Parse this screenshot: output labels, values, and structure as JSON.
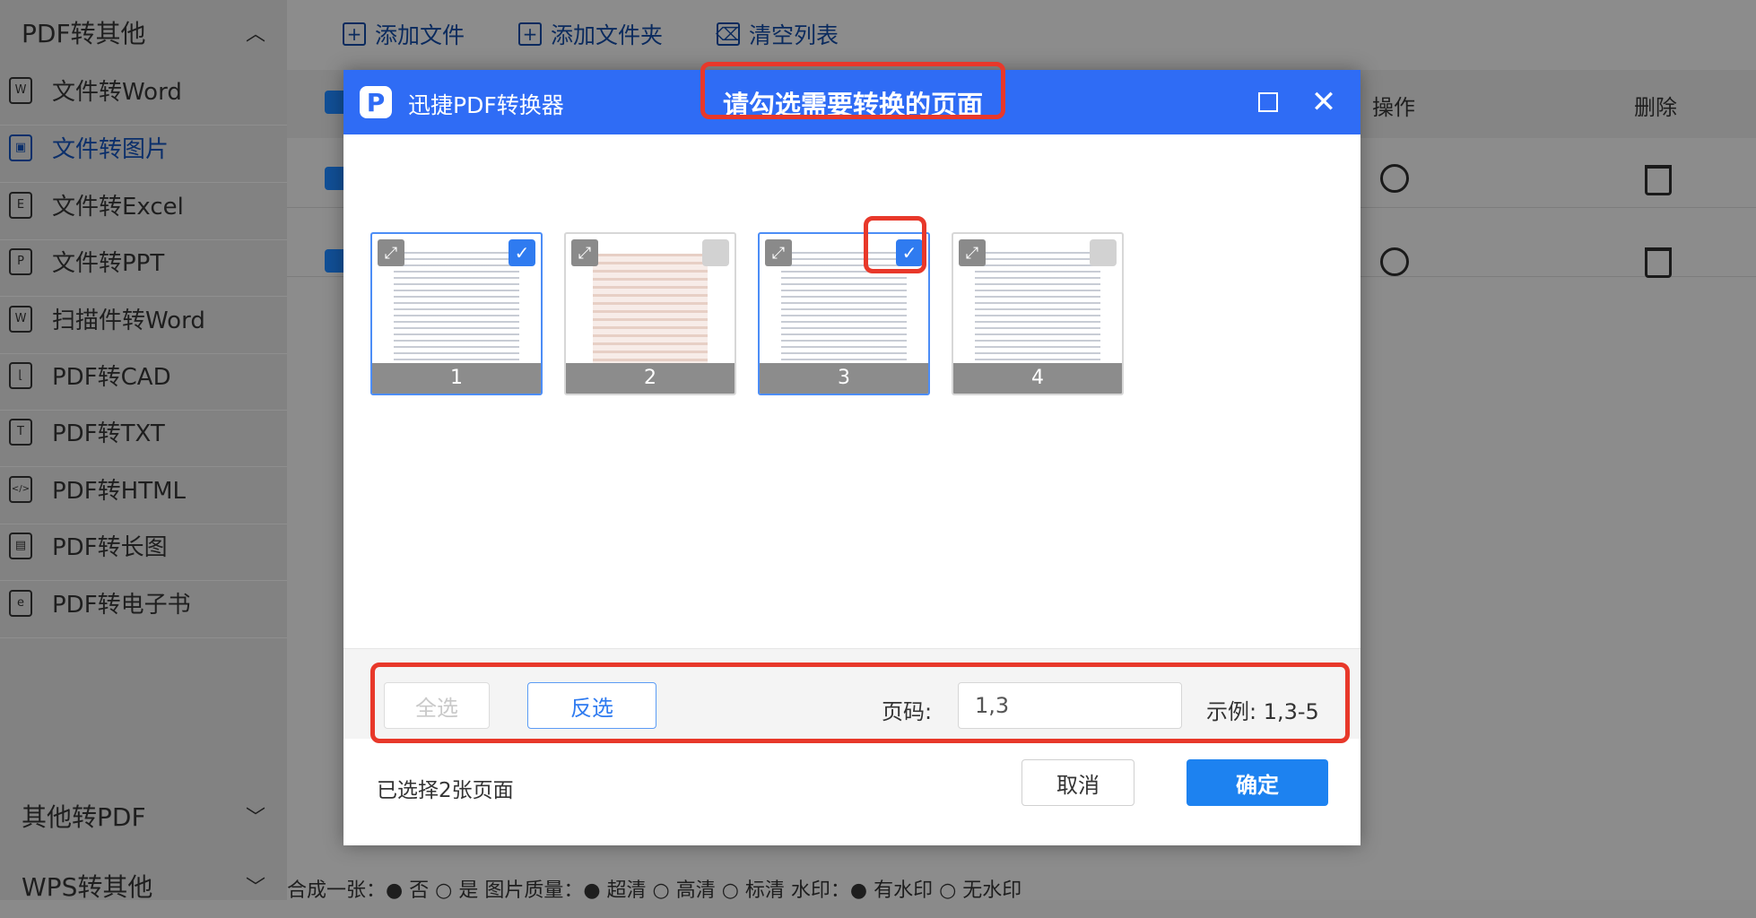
{
  "sidebar": {
    "group_top": "PDF转其他",
    "items": [
      {
        "label": "文件转Word",
        "icon": "W"
      },
      {
        "label": "文件转图片",
        "icon": "▣"
      },
      {
        "label": "文件转Excel",
        "icon": "E"
      },
      {
        "label": "文件转PPT",
        "icon": "P"
      },
      {
        "label": "扫描件转Word",
        "icon": "W"
      },
      {
        "label": "PDF转CAD",
        "icon": "⌊"
      },
      {
        "label": "PDF转TXT",
        "icon": "T"
      },
      {
        "label": "PDF转HTML",
        "icon": "</>"
      },
      {
        "label": "PDF转长图",
        "icon": "▤"
      },
      {
        "label": "PDF转电子书",
        "icon": "e"
      }
    ],
    "group_other": "其他转PDF",
    "group_wps": "WPS转其他",
    "active_index": 1
  },
  "toolbar": {
    "add_file": "添加文件",
    "add_folder": "添加文件夹",
    "clear_list": "清空列表"
  },
  "table": {
    "col_operation": "操作",
    "col_delete": "删除"
  },
  "bottom_bar": {
    "text": "合成一张：● 否  ○ 是      图片质量：● 超清  ○ 高清  ○ 标清      水印：● 有水印  ○ 无水印"
  },
  "modal": {
    "app_name": "迅捷PDF转换器",
    "title": "请勾选需要转换的页面",
    "pages": [
      {
        "number": "1",
        "selected": true
      },
      {
        "number": "2",
        "selected": false
      },
      {
        "number": "3",
        "selected": true
      },
      {
        "number": "4",
        "selected": false
      }
    ],
    "select_all": "全选",
    "invert_selection": "反选",
    "page_label": "页码:",
    "page_input_value": "1,3",
    "example": "示例: 1,3-5",
    "selected_count": "已选择2张页面",
    "cancel": "取消",
    "confirm": "确定"
  },
  "colors": {
    "header_blue": "#2f6cf5",
    "primary_button": "#1d82f0",
    "highlight_red": "#e8382a"
  }
}
